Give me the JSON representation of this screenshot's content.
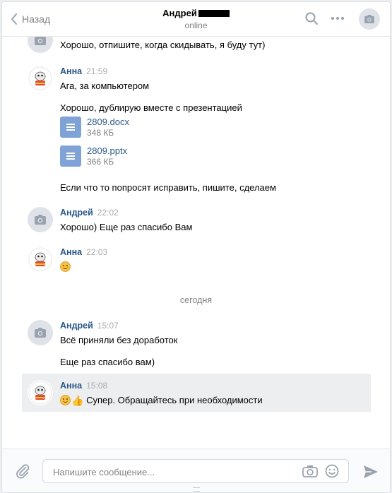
{
  "header": {
    "back_label": "Назад",
    "title": "Андрей",
    "status": "online",
    "icons": [
      "back-arrow-icon",
      "search-icon",
      "more-icon",
      "camera-icon"
    ]
  },
  "messages": [
    {
      "author": "",
      "time": "",
      "lines": [
        "Хорошо, отпишите, когда скидывать, я буду тут)"
      ]
    },
    {
      "author": "Анна",
      "time": "21:59",
      "lines": [
        "Ага, за компьютером",
        "Хорошо, дублирую вместе с презентацией"
      ],
      "docs": [
        {
          "name": "2809.docx",
          "size": "348 КБ"
        },
        {
          "name": "2809.pptx",
          "size": "366 КБ"
        }
      ],
      "after": "Если что то попросят исправить, пишите, сделаем"
    },
    {
      "author": "Андрей",
      "time": "22:02",
      "lines": [
        "Хорошо) Еще раз спасибо Вам"
      ]
    },
    {
      "author": "Анна",
      "time": "22:03"
    },
    {
      "author": "Андрей",
      "time": "15:07",
      "lines": [
        "Всё приняли без доработок",
        "Еще раз спасибо вам)"
      ]
    },
    {
      "author": "Анна",
      "time": "15:08",
      "lines": [
        "Супер. Обращайтесь при необходимости"
      ]
    }
  ],
  "day_divider": "сегодня",
  "composer": {
    "placeholder": "Напишите сообщение..."
  },
  "colors": {
    "link": "#2a5885",
    "meta": "#828282",
    "accent": "#5181b8"
  }
}
